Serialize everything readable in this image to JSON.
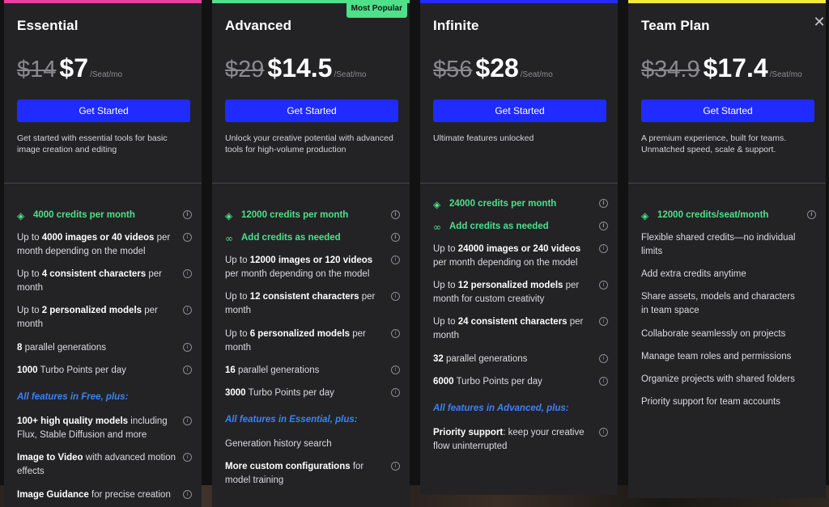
{
  "close_icon": "close-icon",
  "plans": [
    {
      "name": "Essential",
      "bar_color": "#e83fa0",
      "old_price": "$14",
      "new_price": "$7",
      "unit": "/Seat/mo",
      "cta": "Get Started",
      "desc": "Get started with essential tools for basic image creation and editing",
      "badge": "",
      "features": [
        {
          "kind": "green",
          "icon": "gem-icon",
          "html": "4000 credits per month",
          "info": true
        },
        {
          "kind": "normal",
          "parts": [
            "Up to ",
            "4000 images or 40 videos",
            " per month depending on the model"
          ],
          "info": true
        },
        {
          "kind": "normal",
          "parts": [
            "Up to ",
            "4 consistent characters",
            " per month"
          ],
          "info": true
        },
        {
          "kind": "normal",
          "parts": [
            "Up to ",
            "2 personalized models",
            " per month"
          ],
          "info": true
        },
        {
          "kind": "normal",
          "parts": [
            "",
            "8",
            " parallel generations"
          ],
          "info": true
        },
        {
          "kind": "normal",
          "parts": [
            "",
            "1000",
            " Turbo Points per day"
          ],
          "info": true
        },
        {
          "kind": "section",
          "text": "All features in Free, plus:"
        },
        {
          "kind": "normal",
          "parts": [
            "",
            "100+ high quality models",
            " including Flux, Stable Diffusion and more"
          ],
          "info": true
        },
        {
          "kind": "normal",
          "parts": [
            "",
            "Image to Video",
            " with advanced motion effects"
          ],
          "info": true
        },
        {
          "kind": "normal",
          "parts": [
            "",
            "Image Guidance",
            " for precise creation"
          ],
          "info": true
        }
      ]
    },
    {
      "name": "Advanced",
      "bar_color": "#4fe08a",
      "old_price": "$29",
      "new_price": "$14.5",
      "unit": "/Seat/mo",
      "cta": "Get Started",
      "desc": "Unlock your creative potential with advanced tools for high-volume production",
      "badge": "Most Popular",
      "features": [
        {
          "kind": "green",
          "icon": "gem-icon",
          "html": "12000 credits per month",
          "info": true
        },
        {
          "kind": "green",
          "icon": "infinity-icon",
          "html": "Add credits as needed",
          "info": true
        },
        {
          "kind": "normal",
          "parts": [
            "Up to ",
            "12000 images or 120 videos",
            " per month depending on the model"
          ],
          "info": true
        },
        {
          "kind": "normal",
          "parts": [
            "Up to ",
            "12 consistent characters",
            " per month"
          ],
          "info": true
        },
        {
          "kind": "normal",
          "parts": [
            "Up to ",
            "6 personalized models",
            " per month"
          ],
          "info": true
        },
        {
          "kind": "normal",
          "parts": [
            "",
            "16",
            " parallel generations"
          ],
          "info": true
        },
        {
          "kind": "normal",
          "parts": [
            "",
            "3000",
            " Turbo Points per day"
          ],
          "info": true
        },
        {
          "kind": "section",
          "text": "All features in Essential, plus:"
        },
        {
          "kind": "normal",
          "parts": [
            "Generation history search",
            "",
            ""
          ],
          "info": false
        },
        {
          "kind": "normal",
          "parts": [
            "",
            "More custom configurations",
            " for model training"
          ],
          "info": true
        }
      ]
    },
    {
      "name": "Infinite",
      "bar_color": "#1f2bff",
      "old_price": "$56",
      "new_price": "$28",
      "unit": "/Seat/mo",
      "cta": "Get Started",
      "desc": "Ultimate features unlocked",
      "badge": "",
      "features": [
        {
          "kind": "green",
          "icon": "gem-icon",
          "html": "24000 credits per month",
          "info": true
        },
        {
          "kind": "green",
          "icon": "infinity-icon",
          "html": "Add credits as needed",
          "info": true
        },
        {
          "kind": "normal",
          "parts": [
            "Up to ",
            "24000 images or 240 videos",
            " per month depending on the model"
          ],
          "info": true
        },
        {
          "kind": "normal",
          "parts": [
            "Up to ",
            "12 personalized models",
            " per month for custom creativity"
          ],
          "info": true
        },
        {
          "kind": "normal",
          "parts": [
            "Up to ",
            "24 consistent characters",
            " per month"
          ],
          "info": true
        },
        {
          "kind": "normal",
          "parts": [
            "",
            "32",
            " parallel generations"
          ],
          "info": true
        },
        {
          "kind": "normal",
          "parts": [
            "",
            "6000",
            " Turbo Points per day"
          ],
          "info": true
        },
        {
          "kind": "section",
          "text": "All features in Advanced, plus:"
        },
        {
          "kind": "normal",
          "parts": [
            "",
            "Priority support",
            ": keep your creative flow uninterrupted"
          ],
          "info": true
        }
      ]
    },
    {
      "name": "Team Plan",
      "bar_color": "#f5ea3a",
      "old_price": "$34.9",
      "new_price": "$17.4",
      "unit": "/Seat/mo",
      "cta": "Get Started",
      "desc": "A premium experience, built for teams. Unmatched speed, scale & support.",
      "badge": "",
      "features": [
        {
          "kind": "green",
          "icon": "gem-icon",
          "html": "12000 credits/seat/month",
          "info": true
        },
        {
          "kind": "normal",
          "parts": [
            "Flexible shared credits—no individual limits",
            "",
            ""
          ],
          "info": false
        },
        {
          "kind": "normal",
          "parts": [
            "Add extra credits anytime",
            "",
            ""
          ],
          "info": false
        },
        {
          "kind": "normal",
          "parts": [
            "Share assets, models and characters in team space",
            "",
            ""
          ],
          "info": false
        },
        {
          "kind": "normal",
          "parts": [
            "Collaborate seamlessly on projects",
            "",
            ""
          ],
          "info": false
        },
        {
          "kind": "normal",
          "parts": [
            "Manage team roles and permissions",
            "",
            ""
          ],
          "info": false
        },
        {
          "kind": "normal",
          "parts": [
            "Organize projects with shared folders",
            "",
            ""
          ],
          "info": false
        },
        {
          "kind": "normal",
          "parts": [
            "Priority support for team accounts",
            "",
            ""
          ],
          "info": false
        }
      ]
    }
  ]
}
